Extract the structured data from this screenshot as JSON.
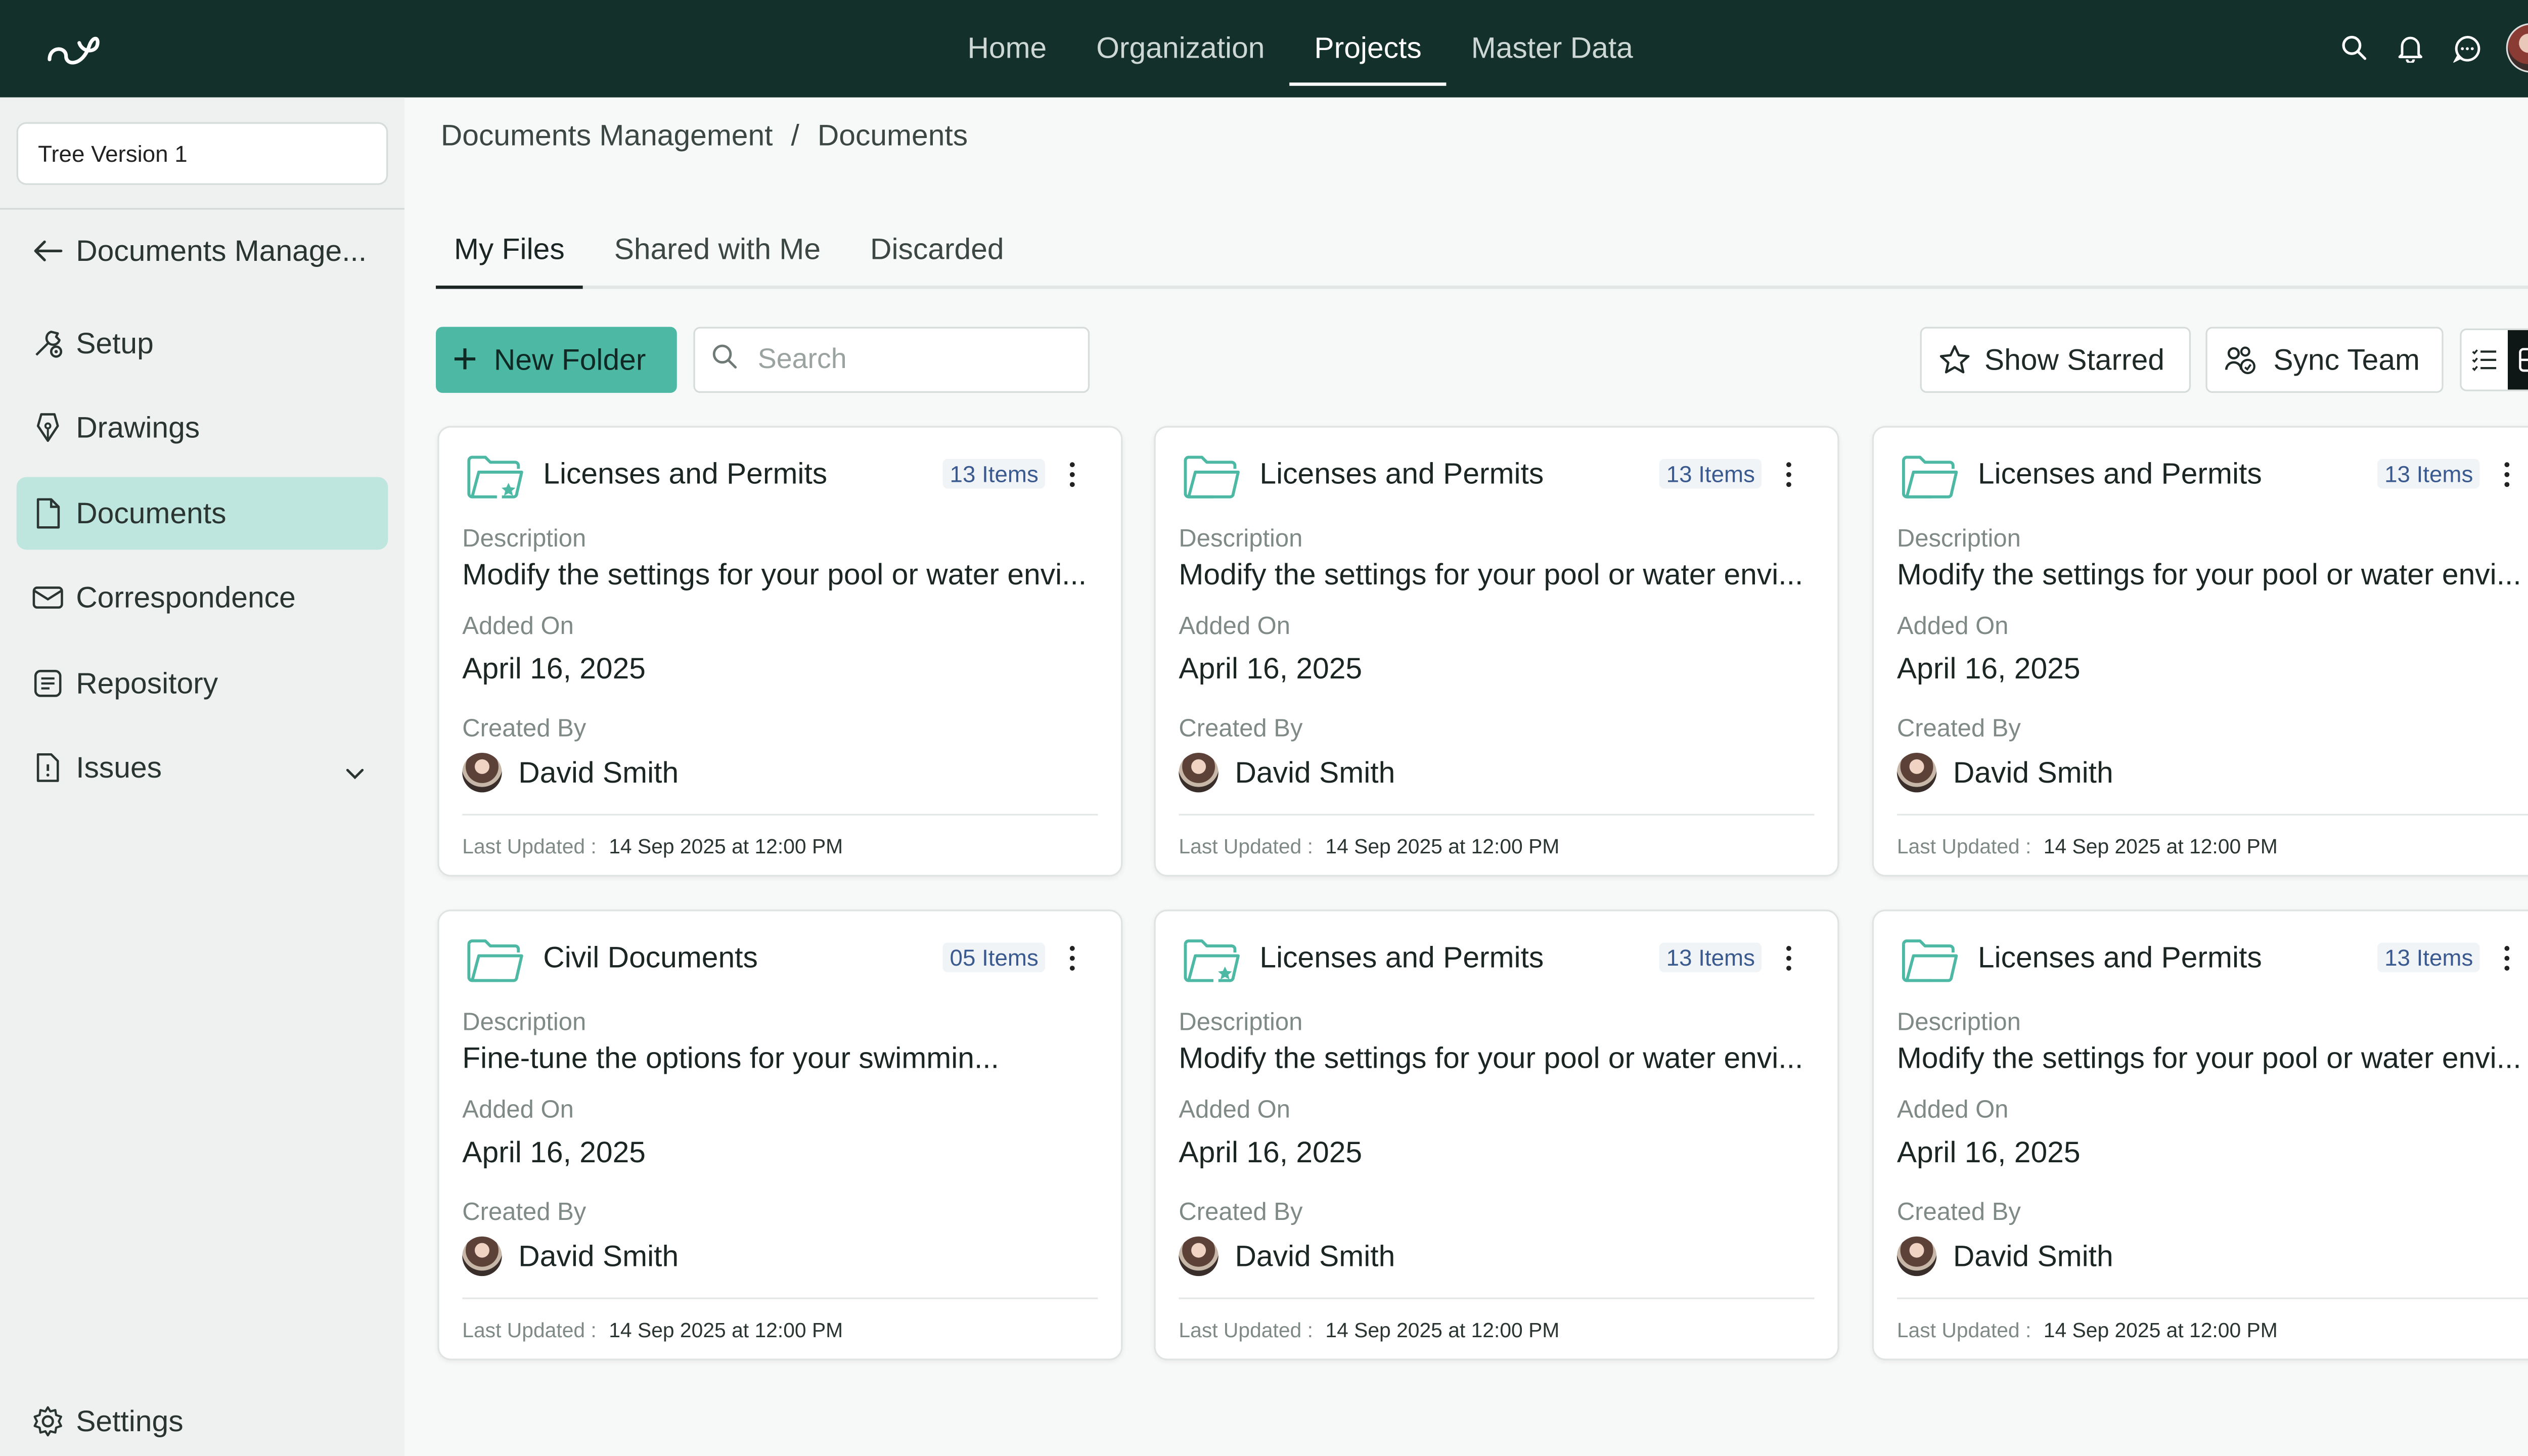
{
  "nav": {
    "items": [
      {
        "label": "Home",
        "active": false
      },
      {
        "label": "Organization",
        "active": false
      },
      {
        "label": "Projects",
        "active": true
      },
      {
        "label": "Master Data",
        "active": false
      }
    ]
  },
  "sidebar": {
    "tree_version": "Tree Version 1",
    "back_label": "Documents Manage...",
    "items": [
      {
        "label": "Setup",
        "icon": "setup-icon"
      },
      {
        "label": "Drawings",
        "icon": "drawing-pen-icon"
      },
      {
        "label": "Documents",
        "icon": "document-icon",
        "active": true
      },
      {
        "label": "Correspondence",
        "icon": "mail-icon"
      },
      {
        "label": "Repository",
        "icon": "repository-icon"
      },
      {
        "label": "Issues",
        "icon": "issue-icon"
      }
    ],
    "settings_label": "Settings"
  },
  "breadcrumb": {
    "parent": "Documents Management",
    "separator": "/",
    "current": "Documents"
  },
  "tabs": [
    {
      "label": "My Files",
      "active": true
    },
    {
      "label": "Shared with Me",
      "active": false
    },
    {
      "label": "Discarded",
      "active": false
    }
  ],
  "toolbar": {
    "new_folder_label": "New Folder",
    "search_placeholder": "Search",
    "show_starred_label": "Show Starred",
    "sync_team_label": "Sync Team"
  },
  "card_labels": {
    "description": "Description",
    "added_on": "Added On",
    "created_by": "Created By",
    "last_updated": "Last Updated :"
  },
  "folders": [
    {
      "title": "Licenses and Permits",
      "count": "13 Items",
      "description": "Modify the settings for your pool or water envi...",
      "added_on": "April 16, 2025",
      "created_by": "David Smith",
      "last_updated": "14 Sep 2025 at 12:00 PM",
      "starred": true
    },
    {
      "title": "Licenses and Permits",
      "count": "13 Items",
      "description": "Modify the settings for your pool or water envi...",
      "added_on": "April 16, 2025",
      "created_by": "David Smith",
      "last_updated": "14 Sep 2025 at 12:00 PM",
      "starred": false
    },
    {
      "title": "Licenses and Permits",
      "count": "13 Items",
      "description": "Modify the settings for your pool or water envi...",
      "added_on": "April 16, 2025",
      "created_by": "David Smith",
      "last_updated": "14 Sep 2025 at 12:00 PM",
      "starred": false
    },
    {
      "title": "Civil Documents",
      "count": "05 Items",
      "description": "Fine-tune the options for your swimmin...",
      "added_on": "April 16, 2025",
      "created_by": "David Smith",
      "last_updated": "14 Sep 2025 at 12:00 PM",
      "starred": false
    },
    {
      "title": "Licenses and Permits",
      "count": "13 Items",
      "description": "Modify the settings for your pool or water envi...",
      "added_on": "April 16, 2025",
      "created_by": "David Smith",
      "last_updated": "14 Sep 2025 at 12:00 PM",
      "starred": true
    },
    {
      "title": "Licenses and Permits",
      "count": "13 Items",
      "description": "Modify the settings for your pool or water envi...",
      "added_on": "April 16, 2025",
      "created_by": "David Smith",
      "last_updated": "14 Sep 2025 at 12:00 PM",
      "starred": false
    }
  ],
  "colors": {
    "topbar": "#13302b",
    "accent": "#4db8a4",
    "sidebar_active": "#bfe5df"
  }
}
